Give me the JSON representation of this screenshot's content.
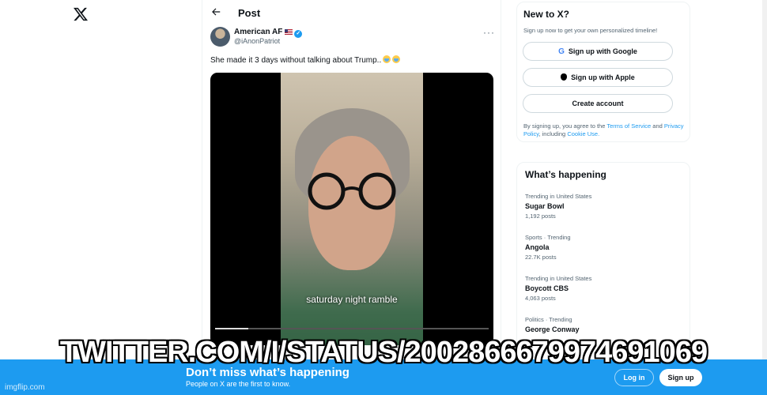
{
  "header": {
    "title": "Post"
  },
  "tweet": {
    "author_name": "American AF",
    "author_handle": "@iAnonPatriot",
    "text": "She made it 3 days without talking about Trump..",
    "video_caption": "saturday night ramble",
    "video_progress": 0.12
  },
  "new_to_x": {
    "title": "New to X?",
    "subtitle": "Sign up now to get your own personalized timeline!",
    "google_label": "Sign up with Google",
    "apple_label": "Sign up with Apple",
    "create_label": "Create account",
    "legal_prefix": "By signing up, you agree to the ",
    "terms_link": "Terms of Service",
    "legal_and": " and ",
    "privacy_link": "Privacy Policy",
    "legal_cookie": ", including ",
    "cookie_link": "Cookie Use."
  },
  "happening": {
    "title": "What’s happening",
    "trends": [
      {
        "meta": "Trending in United States",
        "name": "Sugar Bowl",
        "count": "1,192 posts"
      },
      {
        "meta": "Sports · Trending",
        "name": "Angola",
        "count": "22.7K posts"
      },
      {
        "meta": "Trending in United States",
        "name": "Boycott CBS",
        "count": "4,063 posts"
      },
      {
        "meta": "Politics · Trending",
        "name": "George Conway",
        "count": ""
      }
    ]
  },
  "banner": {
    "title": "Don’t miss what’s happening",
    "subtitle": "People on X are the first to know.",
    "login_label": "Log in",
    "signup_label": "Sign up"
  },
  "overlay": {
    "text": "TWITTER.COM/I/STATUS/2002866679974691069"
  },
  "watermark": "imgflip.com",
  "colors": {
    "accent": "#1d9bf0",
    "text": "#0f1419",
    "muted": "#536471"
  }
}
